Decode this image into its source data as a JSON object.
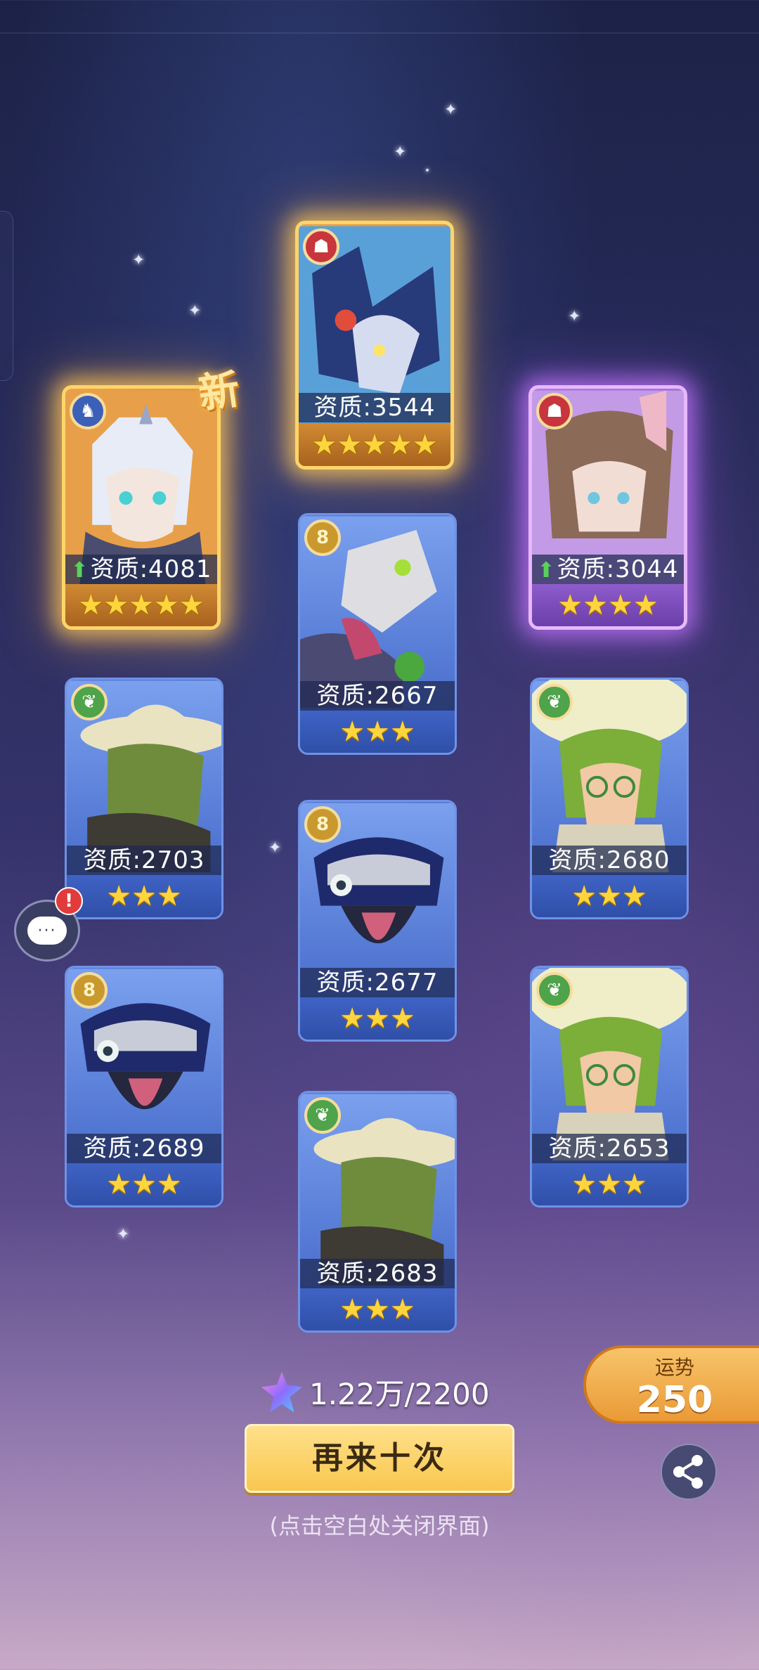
{
  "cards": [
    {
      "id": "c1",
      "rarity": "gold",
      "badge": "horn",
      "badge_glyph": "♞",
      "quality_label": "↑ 资质:4081",
      "stars": "★★★★★",
      "is_new": true,
      "art": "silver-haired-dragon-knight"
    },
    {
      "id": "c2",
      "rarity": "gold",
      "badge": "mask",
      "badge_glyph": "☗",
      "quality_label": "资质:3544",
      "stars": "★★★★★",
      "is_new": false,
      "art": "navy-crested-dragon"
    },
    {
      "id": "c3",
      "rarity": "purple",
      "badge": "mask",
      "badge_glyph": "☗",
      "quality_label": "↑ 资质:3044",
      "stars": "★★★★",
      "is_new": false,
      "art": "hooded-bunny-girl"
    },
    {
      "id": "c4",
      "rarity": "blue",
      "badge": "eight",
      "badge_glyph": "8",
      "quality_label": "资质:2667",
      "stars": "★★★",
      "is_new": false,
      "art": "skull-robot"
    },
    {
      "id": "c5",
      "rarity": "blue",
      "badge": "leaf",
      "badge_glyph": "❦",
      "quality_label": "资质:2703",
      "stars": "★★★",
      "is_new": false,
      "art": "cowboy-cactus"
    },
    {
      "id": "c6",
      "rarity": "blue",
      "badge": "leaf",
      "badge_glyph": "❦",
      "quality_label": "资质:2680",
      "stars": "★★★",
      "is_new": false,
      "art": "curly-mushroom-kid"
    },
    {
      "id": "c7",
      "rarity": "blue",
      "badge": "eight",
      "badge_glyph": "8",
      "quality_label": "资质:2677",
      "stars": "★★★",
      "is_new": false,
      "art": "tongue-crown-monster"
    },
    {
      "id": "c8",
      "rarity": "blue",
      "badge": "eight",
      "badge_glyph": "8",
      "quality_label": "资质:2689",
      "stars": "★★★",
      "is_new": false,
      "art": "tongue-crown-monster"
    },
    {
      "id": "c9",
      "rarity": "blue",
      "badge": "leaf",
      "badge_glyph": "❦",
      "quality_label": "资质:2653",
      "stars": "★★★",
      "is_new": false,
      "art": "curly-mushroom-kid"
    },
    {
      "id": "c10",
      "rarity": "blue",
      "badge": "leaf",
      "badge_glyph": "❦",
      "quality_label": "资质:2683",
      "stars": "★★★",
      "is_new": false,
      "art": "cowboy-cactus"
    }
  ],
  "new_tag": "新",
  "currency": {
    "icon": "star-gem-icon",
    "text": "1.22万/2200"
  },
  "retry_button": "再来十次",
  "hint": "(点击空白处关闭界面)",
  "fortune": {
    "label": "运势",
    "value": "250"
  },
  "chat": {
    "icon": "chat-bubble-icon",
    "bubble": "···",
    "alert": "!"
  },
  "share": {
    "icon": "share-icon"
  }
}
